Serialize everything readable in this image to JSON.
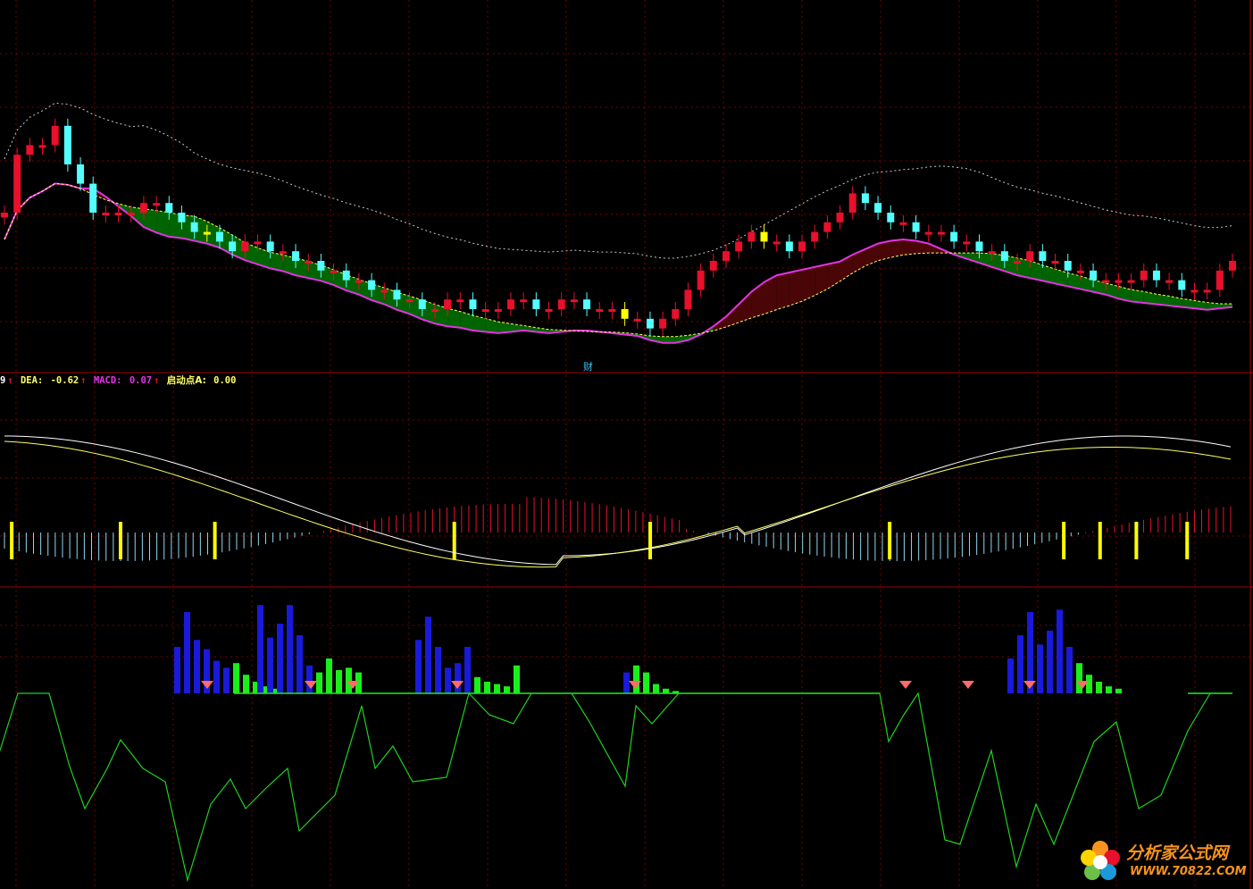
{
  "legend": {
    "lead": "9",
    "arrow": "↑",
    "dea_label": "DEA:",
    "dea_value": "-0.62",
    "macd_label": "MACD:",
    "macd_value": "0.07",
    "start_label": "启动点A:",
    "start_value": "0.00"
  },
  "marker_text": "财",
  "watermark": {
    "cn": "分析家公式网",
    "url": "WWW.70822.COM"
  },
  "colors": {
    "background": "#000000",
    "grid": "#7a0000",
    "up_candle": "#e8102a",
    "down_candle": "#54ffff",
    "signal_candle": "#ffff00",
    "ma_band_green": "#006400",
    "ma_band_dark": "#4a0606",
    "ma_line": "#e433e4",
    "dashed_line": "#c8c8c8",
    "dif_line": "#ffffff",
    "dea_line": "#ffff66",
    "macd_up": "#e8102a",
    "macd_down": "#8fd9ef",
    "vol_blue": "#1a1adb",
    "vol_green": "#1aef1a",
    "osc_line": "#1fd21f",
    "watermark": "#f7931e"
  },
  "chart_data": {
    "type": "candlestick",
    "panels": [
      "price",
      "macd",
      "indicator"
    ],
    "price_closes": [
      27,
      33,
      34,
      34,
      36,
      32,
      30,
      27,
      27,
      27,
      27,
      28,
      28,
      27,
      26,
      25,
      25,
      24,
      23,
      24,
      24,
      23,
      23,
      22,
      22,
      21,
      21,
      20,
      20,
      19,
      19,
      18,
      18,
      17,
      17,
      18,
      18,
      17,
      17,
      17,
      18,
      18,
      17,
      17,
      18,
      18,
      17,
      17,
      17,
      16,
      16,
      15,
      16,
      17,
      19,
      21,
      22,
      23,
      24,
      25,
      24,
      24,
      23,
      24,
      25,
      26,
      27,
      29,
      28,
      27,
      26,
      26,
      25,
      25,
      25,
      24,
      24,
      23,
      23,
      22,
      22,
      23,
      22,
      22,
      21,
      21,
      20,
      20,
      20,
      20,
      21,
      20,
      20,
      19,
      19,
      19,
      21,
      22
    ],
    "macd_yellow_bar_positions": [
      1,
      16,
      29,
      62,
      89,
      122,
      146,
      151,
      156,
      163
    ],
    "indicator_blue_bars": [
      20,
      35,
      23,
      19,
      14,
      11,
      38,
      24,
      30,
      38,
      25,
      12,
      23,
      33,
      20,
      11,
      13,
      20,
      9,
      15,
      25,
      35,
      21,
      27,
      36,
      20
    ],
    "indicator_green_bars": [
      13,
      8,
      5,
      3,
      2,
      9,
      15,
      10,
      11,
      9,
      7,
      5,
      4,
      3,
      12,
      12,
      9,
      4,
      2,
      1
    ]
  }
}
